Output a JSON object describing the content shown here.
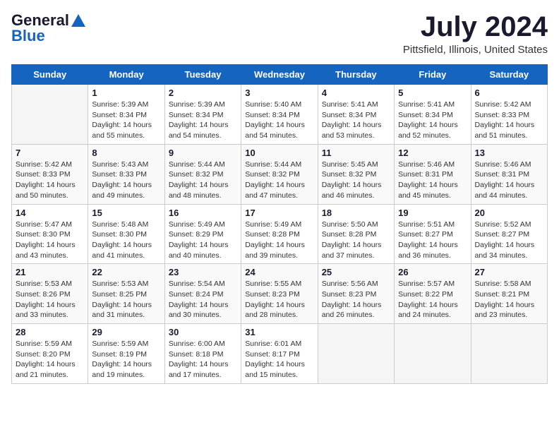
{
  "logo": {
    "general": "General",
    "blue": "Blue"
  },
  "title": "July 2024",
  "location": "Pittsfield, Illinois, United States",
  "days_of_week": [
    "Sunday",
    "Monday",
    "Tuesday",
    "Wednesday",
    "Thursday",
    "Friday",
    "Saturday"
  ],
  "weeks": [
    [
      {
        "day": "",
        "info": ""
      },
      {
        "day": "1",
        "info": "Sunrise: 5:39 AM\nSunset: 8:34 PM\nDaylight: 14 hours\nand 55 minutes."
      },
      {
        "day": "2",
        "info": "Sunrise: 5:39 AM\nSunset: 8:34 PM\nDaylight: 14 hours\nand 54 minutes."
      },
      {
        "day": "3",
        "info": "Sunrise: 5:40 AM\nSunset: 8:34 PM\nDaylight: 14 hours\nand 54 minutes."
      },
      {
        "day": "4",
        "info": "Sunrise: 5:41 AM\nSunset: 8:34 PM\nDaylight: 14 hours\nand 53 minutes."
      },
      {
        "day": "5",
        "info": "Sunrise: 5:41 AM\nSunset: 8:34 PM\nDaylight: 14 hours\nand 52 minutes."
      },
      {
        "day": "6",
        "info": "Sunrise: 5:42 AM\nSunset: 8:33 PM\nDaylight: 14 hours\nand 51 minutes."
      }
    ],
    [
      {
        "day": "7",
        "info": "Sunrise: 5:42 AM\nSunset: 8:33 PM\nDaylight: 14 hours\nand 50 minutes."
      },
      {
        "day": "8",
        "info": "Sunrise: 5:43 AM\nSunset: 8:33 PM\nDaylight: 14 hours\nand 49 minutes."
      },
      {
        "day": "9",
        "info": "Sunrise: 5:44 AM\nSunset: 8:32 PM\nDaylight: 14 hours\nand 48 minutes."
      },
      {
        "day": "10",
        "info": "Sunrise: 5:44 AM\nSunset: 8:32 PM\nDaylight: 14 hours\nand 47 minutes."
      },
      {
        "day": "11",
        "info": "Sunrise: 5:45 AM\nSunset: 8:32 PM\nDaylight: 14 hours\nand 46 minutes."
      },
      {
        "day": "12",
        "info": "Sunrise: 5:46 AM\nSunset: 8:31 PM\nDaylight: 14 hours\nand 45 minutes."
      },
      {
        "day": "13",
        "info": "Sunrise: 5:46 AM\nSunset: 8:31 PM\nDaylight: 14 hours\nand 44 minutes."
      }
    ],
    [
      {
        "day": "14",
        "info": "Sunrise: 5:47 AM\nSunset: 8:30 PM\nDaylight: 14 hours\nand 43 minutes."
      },
      {
        "day": "15",
        "info": "Sunrise: 5:48 AM\nSunset: 8:30 PM\nDaylight: 14 hours\nand 41 minutes."
      },
      {
        "day": "16",
        "info": "Sunrise: 5:49 AM\nSunset: 8:29 PM\nDaylight: 14 hours\nand 40 minutes."
      },
      {
        "day": "17",
        "info": "Sunrise: 5:49 AM\nSunset: 8:28 PM\nDaylight: 14 hours\nand 39 minutes."
      },
      {
        "day": "18",
        "info": "Sunrise: 5:50 AM\nSunset: 8:28 PM\nDaylight: 14 hours\nand 37 minutes."
      },
      {
        "day": "19",
        "info": "Sunrise: 5:51 AM\nSunset: 8:27 PM\nDaylight: 14 hours\nand 36 minutes."
      },
      {
        "day": "20",
        "info": "Sunrise: 5:52 AM\nSunset: 8:27 PM\nDaylight: 14 hours\nand 34 minutes."
      }
    ],
    [
      {
        "day": "21",
        "info": "Sunrise: 5:53 AM\nSunset: 8:26 PM\nDaylight: 14 hours\nand 33 minutes."
      },
      {
        "day": "22",
        "info": "Sunrise: 5:53 AM\nSunset: 8:25 PM\nDaylight: 14 hours\nand 31 minutes."
      },
      {
        "day": "23",
        "info": "Sunrise: 5:54 AM\nSunset: 8:24 PM\nDaylight: 14 hours\nand 30 minutes."
      },
      {
        "day": "24",
        "info": "Sunrise: 5:55 AM\nSunset: 8:23 PM\nDaylight: 14 hours\nand 28 minutes."
      },
      {
        "day": "25",
        "info": "Sunrise: 5:56 AM\nSunset: 8:23 PM\nDaylight: 14 hours\nand 26 minutes."
      },
      {
        "day": "26",
        "info": "Sunrise: 5:57 AM\nSunset: 8:22 PM\nDaylight: 14 hours\nand 24 minutes."
      },
      {
        "day": "27",
        "info": "Sunrise: 5:58 AM\nSunset: 8:21 PM\nDaylight: 14 hours\nand 23 minutes."
      }
    ],
    [
      {
        "day": "28",
        "info": "Sunrise: 5:59 AM\nSunset: 8:20 PM\nDaylight: 14 hours\nand 21 minutes."
      },
      {
        "day": "29",
        "info": "Sunrise: 5:59 AM\nSunset: 8:19 PM\nDaylight: 14 hours\nand 19 minutes."
      },
      {
        "day": "30",
        "info": "Sunrise: 6:00 AM\nSunset: 8:18 PM\nDaylight: 14 hours\nand 17 minutes."
      },
      {
        "day": "31",
        "info": "Sunrise: 6:01 AM\nSunset: 8:17 PM\nDaylight: 14 hours\nand 15 minutes."
      },
      {
        "day": "",
        "info": ""
      },
      {
        "day": "",
        "info": ""
      },
      {
        "day": "",
        "info": ""
      }
    ]
  ]
}
